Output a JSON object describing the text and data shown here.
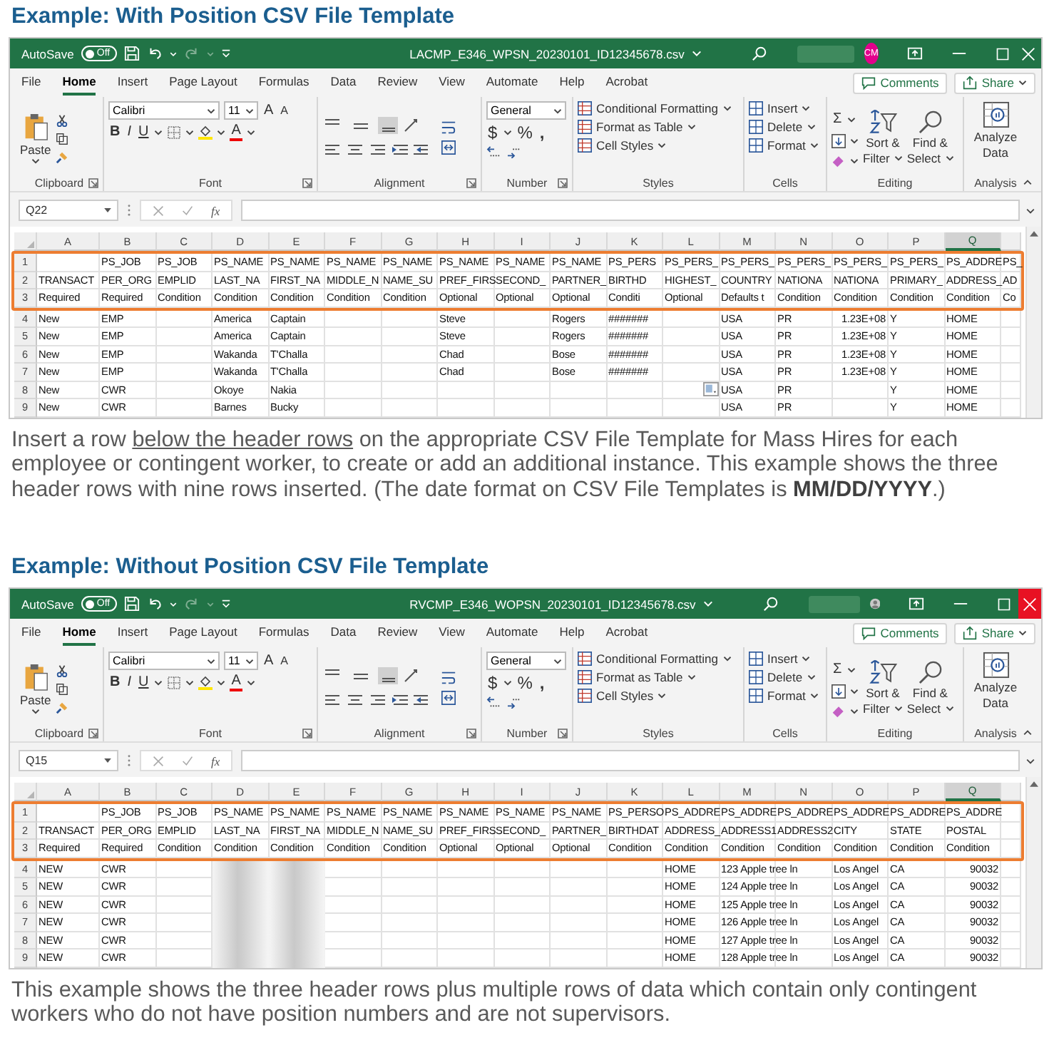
{
  "sections": [
    {
      "heading": "Example: With Position CSV File Template",
      "window": {
        "title_bar": {
          "autosave": "AutoSave",
          "autosave_on": false,
          "toggle_text": "Off",
          "filename": "LACMP_E346_WPSN_20230101_ID12345678.csv",
          "avatar": {
            "kind": "initials",
            "initials": "CM",
            "color": "#e3008c"
          },
          "close_highlighted": false
        },
        "menu_tabs": [
          {
            "label": "File",
            "selected": false
          },
          {
            "label": "Home",
            "selected": true
          },
          {
            "label": "Insert",
            "selected": false
          },
          {
            "label": "Page Layout",
            "selected": false
          },
          {
            "label": "Formulas",
            "selected": false
          },
          {
            "label": "Data",
            "selected": false
          },
          {
            "label": "Review",
            "selected": false
          },
          {
            "label": "View",
            "selected": false
          },
          {
            "label": "Automate",
            "selected": false
          },
          {
            "label": "Help",
            "selected": false
          },
          {
            "label": "Acrobat",
            "selected": false
          }
        ],
        "comments_button": "Comments",
        "share_button": "Share",
        "ribbon": {
          "paste": "Paste",
          "clipboard": "Clipboard",
          "font_name": "Calibri",
          "font_size": "11",
          "grow": "A",
          "shrink": "A",
          "bold": "B",
          "italic": "I",
          "underline": "U",
          "font_color": "A",
          "font": "Font",
          "alignment": "Alignment",
          "number_format": "General",
          "currency": "$",
          "percent": "%",
          "comma": ",",
          "number": "Number",
          "styles": [
            "Conditional Formatting",
            "Format as Table",
            "Cell Styles"
          ],
          "styles_label": "Styles",
          "cells": [
            "Insert",
            "Delete",
            "Format"
          ],
          "cells_label": "Cells",
          "sum": "Σ",
          "sort": [
            "Sort &",
            "Filter"
          ],
          "find": [
            "Find &",
            "Select"
          ],
          "editing": "Editing",
          "analyze": [
            "Analyze",
            "Data"
          ],
          "analysis": "Analysis"
        },
        "formula_bar": {
          "name_box": "Q22",
          "fx": "fx"
        },
        "sheet": {
          "columns": [
            {
              "label": "A",
              "selected": false
            },
            {
              "label": "B",
              "selected": false
            },
            {
              "label": "C",
              "selected": false
            },
            {
              "label": "D",
              "selected": false
            },
            {
              "label": "E",
              "selected": false
            },
            {
              "label": "F",
              "selected": false
            },
            {
              "label": "G",
              "selected": false
            },
            {
              "label": "H",
              "selected": false
            },
            {
              "label": "I",
              "selected": false
            },
            {
              "label": "J",
              "selected": false
            },
            {
              "label": "K",
              "selected": false
            },
            {
              "label": "L",
              "selected": false
            },
            {
              "label": "M",
              "selected": false
            },
            {
              "label": "N",
              "selected": false
            },
            {
              "label": "O",
              "selected": false
            },
            {
              "label": "P",
              "selected": false
            },
            {
              "label": "Q",
              "selected": true
            },
            {
              "selected": false
            }
          ],
          "header_rows_outlined": true,
          "header_rows": [
            {
              "number": "1",
              "cells": [
                null,
                "PS_JOB",
                "PS_JOB",
                "PS_NAME",
                "PS_NAME",
                "PS_NAME",
                "PS_NAME",
                "PS_NAME",
                "PS_NAME",
                "PS_NAME",
                "PS_PERS",
                "PS_PERS_",
                "PS_PERS_",
                "PS_PERS_",
                "PS_PERS_",
                "PS_PERS_",
                "PS_ADDRE",
                "PS_"
              ]
            },
            {
              "number": "2",
              "cells": [
                "TRANSACT",
                "PER_ORG",
                "EMPLID",
                "LAST_NA",
                "FIRST_NA",
                "MIDDLE_N",
                "NAME_SU",
                "PREF_FIRS",
                "SECOND_",
                "PARTNER_",
                "BIRTHD",
                "HIGHEST_",
                "COUNTRY",
                "NATIONA",
                "NATIONA",
                "PRIMARY_",
                "ADDRESS_",
                "AD"
              ]
            },
            {
              "number": "3",
              "cells": [
                "Required",
                "Required",
                "Condition",
                "Condition",
                "Condition",
                "Condition",
                "Condition",
                "Optional",
                "Optional",
                "Optional",
                "Conditi",
                "Optional",
                "Defaults t",
                "Condition",
                "Condition",
                "Condition",
                "Condition",
                "Co"
              ]
            }
          ],
          "data_rows": [
            {
              "number": "4",
              "cells": [
                "New",
                "EMP",
                null,
                "America",
                "Captain",
                null,
                null,
                "Steve",
                null,
                "Rogers",
                "#######",
                null,
                "USA",
                "PR",
                {
                  "text": "1.23E+08",
                  "kind": "number"
                },
                "Y",
                "HOME",
                null
              ]
            },
            {
              "number": "5",
              "cells": [
                "New",
                "EMP",
                null,
                "America",
                "Captain",
                null,
                null,
                "Steve",
                null,
                "Rogers",
                "#######",
                null,
                "USA",
                "PR",
                {
                  "text": "1.23E+08",
                  "kind": "number"
                },
                "Y",
                "HOME",
                null
              ]
            },
            {
              "number": "6",
              "cells": [
                "New",
                "EMP",
                null,
                "Wakanda",
                "T'Challa",
                null,
                null,
                "Chad",
                null,
                "Bose",
                "#######",
                null,
                "USA",
                "PR",
                {
                  "text": "1.23E+08",
                  "kind": "number"
                },
                "Y",
                "HOME",
                null
              ]
            },
            {
              "number": "7",
              "cells": [
                "New",
                "EMP",
                null,
                "Wakanda",
                "T'Challa",
                null,
                null,
                "Chad",
                null,
                "Bose",
                "#######",
                null,
                "USA",
                "PR",
                {
                  "text": "1.23E+08",
                  "kind": "number"
                },
                "Y",
                "HOME",
                null
              ]
            },
            {
              "number": "8",
              "cells": [
                "New",
                "CWR",
                null,
                "Okoye",
                "Nakia",
                null,
                null,
                null,
                null,
                null,
                null,
                {
                  "kind": "paste-options"
                },
                "USA",
                "PR",
                null,
                "Y",
                "HOME",
                null
              ]
            },
            {
              "number": "9",
              "cells": [
                "New",
                "CWR",
                null,
                "Barnes",
                "Bucky",
                null,
                null,
                null,
                null,
                null,
                null,
                null,
                "USA",
                "PR",
                null,
                "Y",
                "HOME",
                null
              ]
            }
          ]
        }
      },
      "paragraph": [
        {
          "text": "Insert a row ",
          "underlined": false
        },
        {
          "text": "below the header rows",
          "underlined": true
        },
        {
          "text": " on the appropriate CSV File Template for Mass Hires for each employee or contingent worker, to create or add an additional instance. This example shows the three header rows with nine rows inserted. (The date format on CSV File Templates is **MM/DD/YYYY**.)",
          "underlined": false
        }
      ]
    },
    {
      "heading": "Example: Without Position CSV File Template",
      "window": {
        "title_bar": {
          "autosave": "AutoSave",
          "autosave_on": false,
          "toggle_text": "Off",
          "filename": "RVCMP_E346_WOPSN_20230101_ID12345678.csv",
          "avatar": {
            "kind": "silhouette"
          },
          "close_highlighted": true
        },
        "menu_tabs": [
          {
            "label": "File",
            "selected": false
          },
          {
            "label": "Home",
            "selected": true
          },
          {
            "label": "Insert",
            "selected": false
          },
          {
            "label": "Page Layout",
            "selected": false
          },
          {
            "label": "Formulas",
            "selected": false
          },
          {
            "label": "Data",
            "selected": false
          },
          {
            "label": "Review",
            "selected": false
          },
          {
            "label": "View",
            "selected": false
          },
          {
            "label": "Automate",
            "selected": false
          },
          {
            "label": "Help",
            "selected": false
          },
          {
            "label": "Acrobat",
            "selected": false
          }
        ],
        "comments_button": "Comments",
        "share_button": "Share",
        "ribbon": {
          "paste": "Paste",
          "clipboard": "Clipboard",
          "font_name": "Calibri",
          "font_size": "11",
          "grow": "A",
          "shrink": "A",
          "bold": "B",
          "italic": "I",
          "underline": "U",
          "font_color": "A",
          "font": "Font",
          "alignment": "Alignment",
          "number_format": "General",
          "currency": "$",
          "percent": "%",
          "comma": ",",
          "number": "Number",
          "styles": [
            "Conditional Formatting",
            "Format as Table",
            "Cell Styles"
          ],
          "styles_label": "Styles",
          "cells": [
            "Insert",
            "Delete",
            "Format"
          ],
          "cells_label": "Cells",
          "sum": "Σ",
          "sort": [
            "Sort &",
            "Filter"
          ],
          "find": [
            "Find &",
            "Select"
          ],
          "editing": "Editing",
          "analyze": [
            "Analyze",
            "Data"
          ],
          "analysis": "Analysis"
        },
        "formula_bar": {
          "name_box": "Q15",
          "fx": "fx"
        },
        "sheet": {
          "columns": [
            {
              "label": "A",
              "selected": false
            },
            {
              "label": "B",
              "selected": false
            },
            {
              "label": "C",
              "selected": false
            },
            {
              "label": "D",
              "selected": false
            },
            {
              "label": "E",
              "selected": false
            },
            {
              "label": "F",
              "selected": false
            },
            {
              "label": "G",
              "selected": false
            },
            {
              "label": "H",
              "selected": false
            },
            {
              "label": "I",
              "selected": false
            },
            {
              "label": "J",
              "selected": false
            },
            {
              "label": "K",
              "selected": false
            },
            {
              "label": "L",
              "selected": false
            },
            {
              "label": "M",
              "selected": false
            },
            {
              "label": "N",
              "selected": false
            },
            {
              "label": "O",
              "selected": false
            },
            {
              "label": "P",
              "selected": false
            },
            {
              "label": "Q",
              "selected": true
            },
            {
              "selected": false
            }
          ],
          "header_rows_outlined": true,
          "header_rows": [
            {
              "number": "1",
              "cells": [
                null,
                "PS_JOB",
                "PS_JOB",
                "PS_NAME",
                "PS_NAME",
                "PS_NAME",
                "PS_NAME",
                "PS_NAME",
                "PS_NAME",
                "PS_NAME",
                "PS_PERSO",
                "PS_ADDRE",
                "PS_ADDRE",
                "PS_ADDRE",
                "PS_ADDRE",
                "PS_ADDRE",
                "PS_ADDRE",
                null
              ]
            },
            {
              "number": "2",
              "cells": [
                "TRANSACT",
                "PER_ORG",
                "EMPLID",
                "LAST_NA",
                "FIRST_NA",
                "MIDDLE_N",
                "NAME_SU",
                "PREF_FIRS",
                "SECOND_",
                "PARTNER_",
                "BIRTHDAT",
                "ADDRESS_",
                "ADDRESS1",
                "ADDRESS2",
                "CITY",
                "STATE",
                "POSTAL",
                null
              ]
            },
            {
              "number": "3",
              "cells": [
                "Required",
                "Required",
                "Condition",
                "Condition",
                "Condition",
                "Condition",
                "Condition",
                "Optional",
                "Optional",
                "Optional",
                "Condition",
                "Condition",
                "Condition",
                "Condition",
                "Condition",
                "Condition",
                "Condition",
                null
              ]
            }
          ],
          "data_rows": [
            {
              "number": "4",
              "cells": [
                "NEW",
                "CWR",
                null,
                {
                  "kind": "blurred"
                },
                {
                  "kind": "blurred"
                },
                null,
                null,
                null,
                null,
                null,
                null,
                "HOME",
                "123 Apple tree ln",
                null,
                "Los Angel",
                "CA",
                {
                  "text": "90032",
                  "kind": "number"
                },
                null
              ]
            },
            {
              "number": "5",
              "cells": [
                "NEW",
                "CWR",
                null,
                {
                  "kind": "blurred"
                },
                {
                  "kind": "blurred"
                },
                null,
                null,
                null,
                null,
                null,
                null,
                "HOME",
                "124 Apple tree ln",
                null,
                "Los Angel",
                "CA",
                {
                  "text": "90032",
                  "kind": "number"
                },
                null
              ]
            },
            {
              "number": "6",
              "cells": [
                "NEW",
                "CWR",
                null,
                {
                  "kind": "blurred"
                },
                {
                  "kind": "blurred"
                },
                null,
                null,
                null,
                null,
                null,
                null,
                "HOME",
                "125 Apple tree ln",
                null,
                "Los Angel",
                "CA",
                {
                  "text": "90032",
                  "kind": "number"
                },
                null
              ]
            },
            {
              "number": "7",
              "cells": [
                "NEW",
                "CWR",
                null,
                {
                  "kind": "blurred"
                },
                {
                  "kind": "blurred"
                },
                null,
                null,
                null,
                null,
                null,
                null,
                "HOME",
                "126 Apple tree ln",
                null,
                "Los Angel",
                "CA",
                {
                  "text": "90032",
                  "kind": "number"
                },
                null
              ]
            },
            {
              "number": "8",
              "cells": [
                "NEW",
                "CWR",
                null,
                {
                  "kind": "blurred"
                },
                {
                  "kind": "blurred"
                },
                null,
                null,
                null,
                null,
                null,
                null,
                "HOME",
                "127 Apple tree ln",
                null,
                "Los Angel",
                "CA",
                {
                  "text": "90032",
                  "kind": "number"
                },
                null
              ]
            },
            {
              "number": "9",
              "cells": [
                "NEW",
                "CWR",
                null,
                {
                  "kind": "blurred"
                },
                {
                  "kind": "blurred"
                },
                null,
                null,
                null,
                null,
                null,
                null,
                "HOME",
                "128 Apple tree ln",
                null,
                "Los Angel",
                "CA",
                {
                  "text": "90032",
                  "kind": "number"
                },
                null
              ]
            }
          ]
        }
      },
      "paragraph": [
        {
          "text": "This example shows the three header rows plus multiple rows of data which contain only contingent workers who do not have position numbers and are not supervisors.",
          "underlined": false
        }
      ]
    }
  ]
}
